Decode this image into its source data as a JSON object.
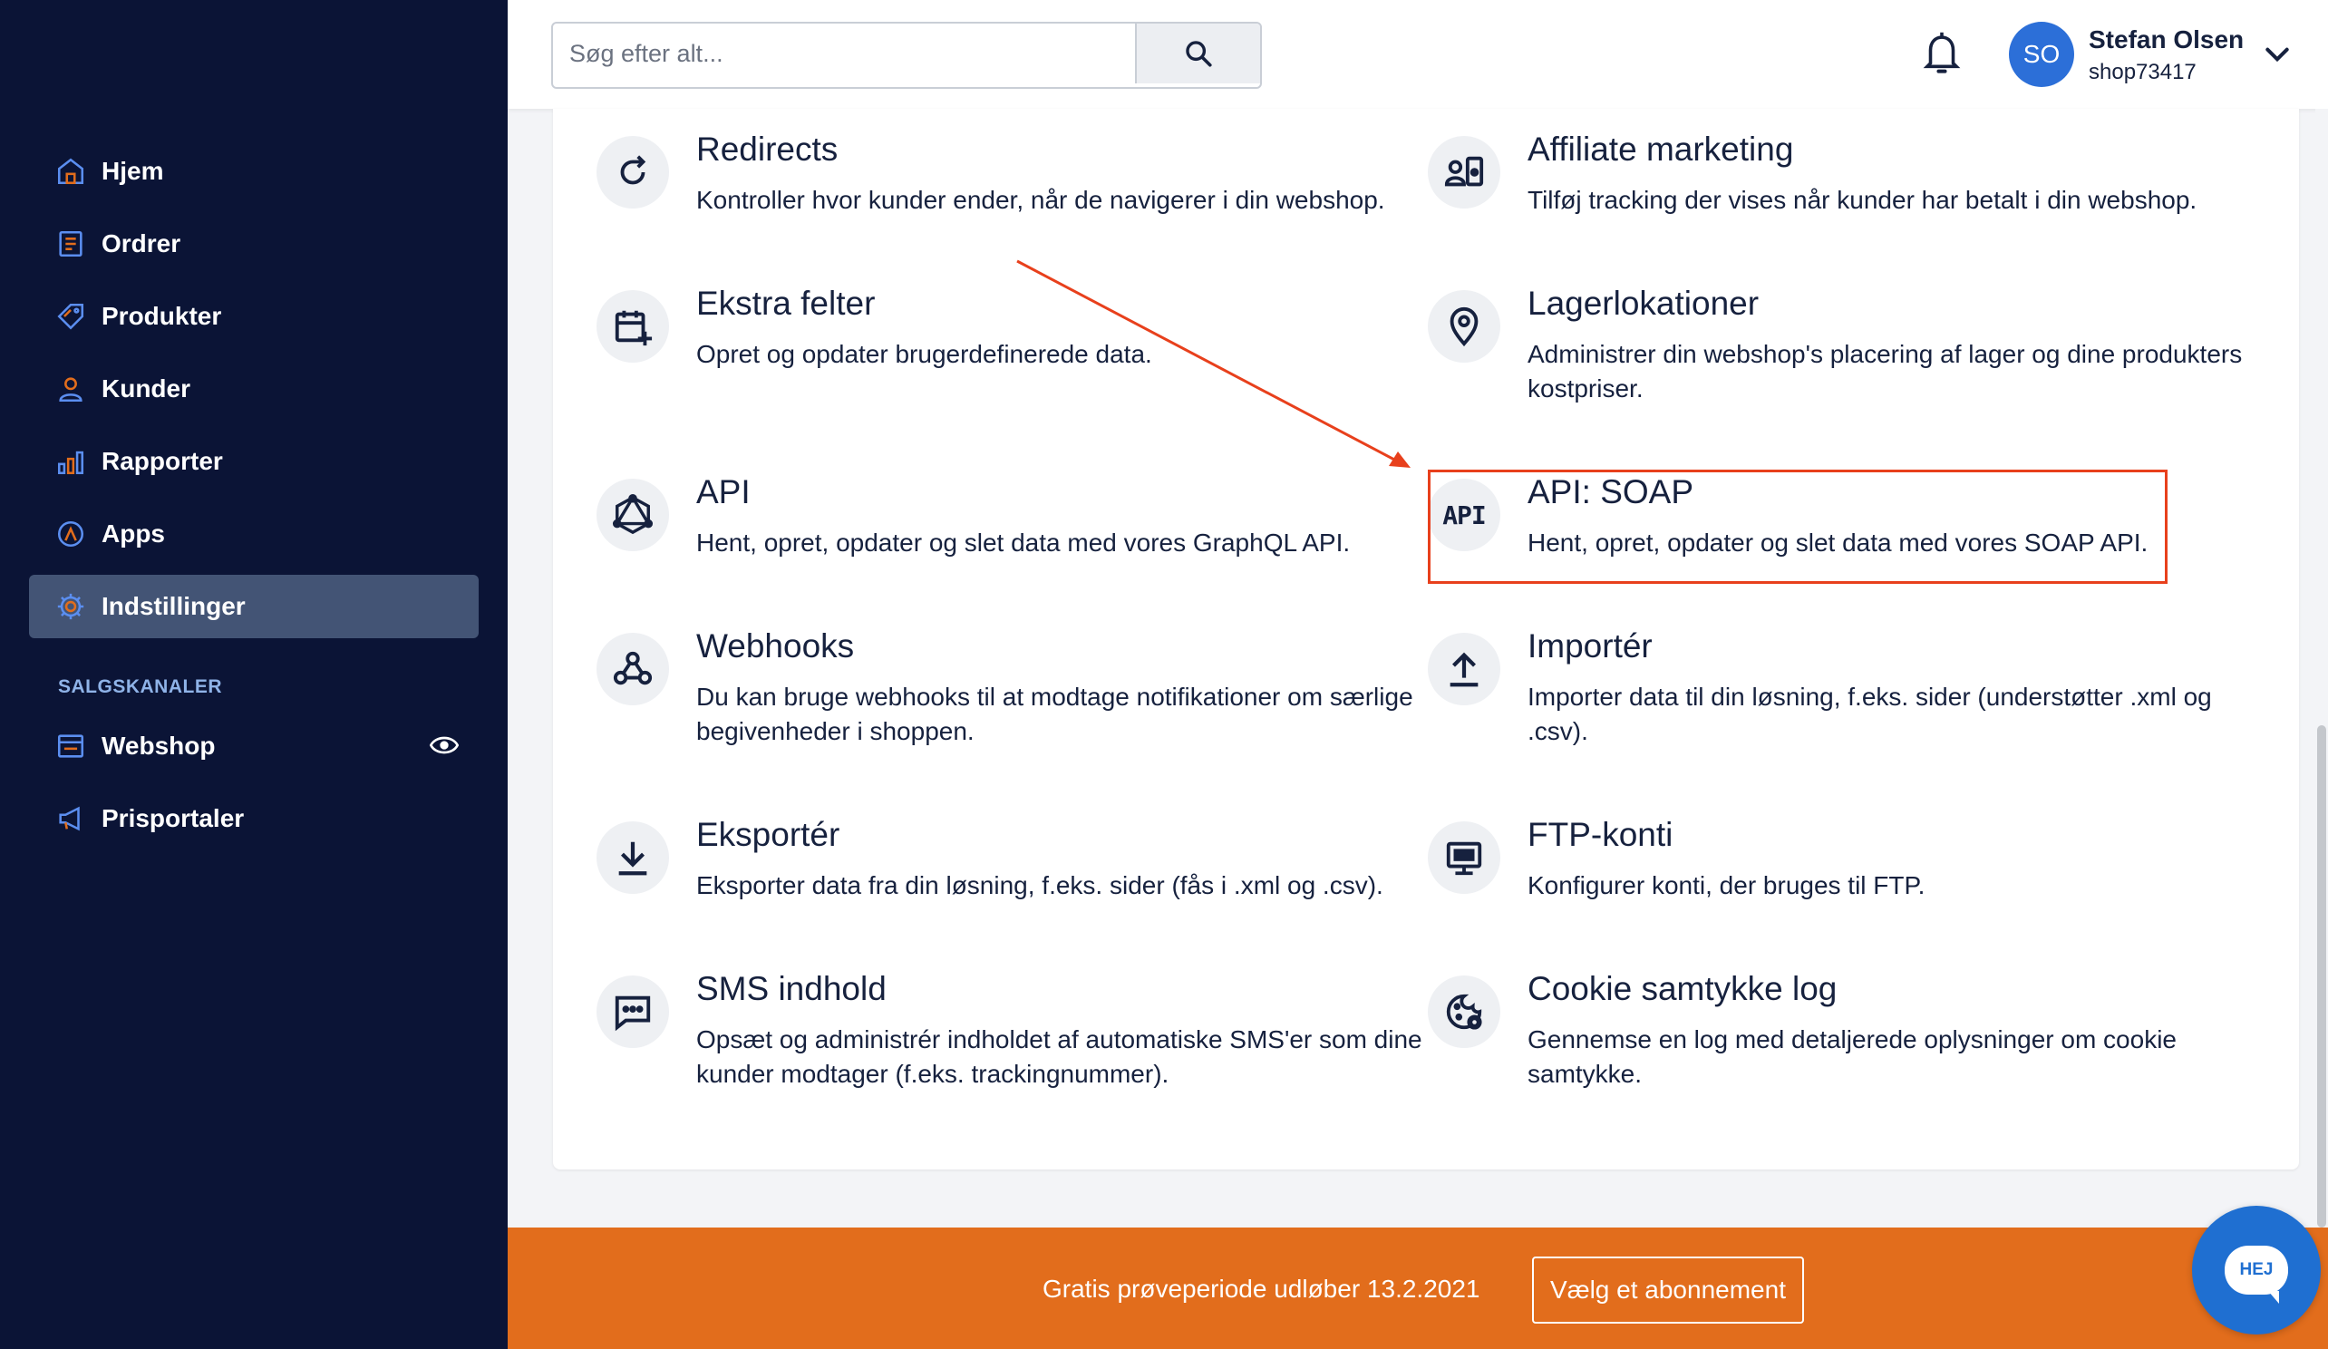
{
  "sidebar": {
    "items": [
      {
        "label": "Hjem",
        "icon": "home-icon"
      },
      {
        "label": "Ordrer",
        "icon": "orders-icon"
      },
      {
        "label": "Produkter",
        "icon": "tag-icon"
      },
      {
        "label": "Kunder",
        "icon": "user-icon"
      },
      {
        "label": "Rapporter",
        "icon": "chart-icon"
      },
      {
        "label": "Apps",
        "icon": "apps-icon"
      },
      {
        "label": "Indstillinger",
        "icon": "gear-icon",
        "active": true
      }
    ],
    "section_title": "SALGSKANALER",
    "channels": [
      {
        "label": "Webshop",
        "icon": "store-icon",
        "extra_icon": "eye-icon"
      },
      {
        "label": "Prisportaler",
        "icon": "megaphone-icon"
      }
    ]
  },
  "header": {
    "search_placeholder": "Søg efter alt...",
    "search_icon": "search-icon",
    "bell_icon": "bell-icon",
    "user": {
      "initials": "SO",
      "name": "Stefan Olsen",
      "shop": "shop73417"
    }
  },
  "settings": [
    {
      "title": "Redirects",
      "desc": "Kontroller hvor kunder ender, når de navigerer i din webshop.",
      "icon": "redirect-icon"
    },
    {
      "title": "Affiliate marketing",
      "desc": "Tilføj tracking der vises når kunder har betalt i din webshop.",
      "icon": "affiliate-icon"
    },
    {
      "title": "Ekstra felter",
      "desc": "Opret og opdater brugerdefinerede data.",
      "icon": "calendar-add-icon"
    },
    {
      "title": "Lagerlokationer",
      "desc": "Administrer din webshop's placering af lager og dine produkters kostpriser.",
      "icon": "location-pin-icon"
    },
    {
      "title": "API",
      "desc": "Hent, opret, opdater og slet data med vores GraphQL API.",
      "icon": "graphql-icon"
    },
    {
      "title": "API: SOAP",
      "desc": "Hent, opret, opdater og slet data med vores SOAP API.",
      "icon": "api-text-icon"
    },
    {
      "title": "Webhooks",
      "desc": "Du kan bruge webhooks til at modtage notifikationer om særlige begivenheder i shoppen.",
      "icon": "webhook-icon"
    },
    {
      "title": "Importér",
      "desc": "Importer data til din løsning, f.eks. sider (understøtter .xml og .csv).",
      "icon": "upload-icon"
    },
    {
      "title": "Eksportér",
      "desc": "Eksporter data fra din løsning, f.eks. sider (fås i .xml og .csv).",
      "icon": "download-icon"
    },
    {
      "title": "FTP-konti",
      "desc": "Konfigurer konti, der bruges til FTP.",
      "icon": "monitor-icon"
    },
    {
      "title": "SMS indhold",
      "desc": "Opsæt og administrér indholdet af automatiske SMS'er som dine kunder modtager (f.eks. trackingnummer).",
      "icon": "message-icon"
    },
    {
      "title": "Cookie samtykke log",
      "desc": "Gennemse en log med detaljerede oplysninger om cookie samtykke.",
      "icon": "cookie-gear-icon"
    }
  ],
  "api_text_icon": "API",
  "trial": {
    "text": "Gratis prøveperiode udløber 13.2.2021",
    "button": "Vælg et abonnement"
  },
  "chat": {
    "label": "HEJ"
  },
  "colors": {
    "sidebar_bg": "#0b1436",
    "active_bg": "#435475",
    "accent_orange": "#e26d1c",
    "highlight": "#e8401c",
    "avatar": "#2c6fd8",
    "icon_blue": "#1f6fd1"
  }
}
